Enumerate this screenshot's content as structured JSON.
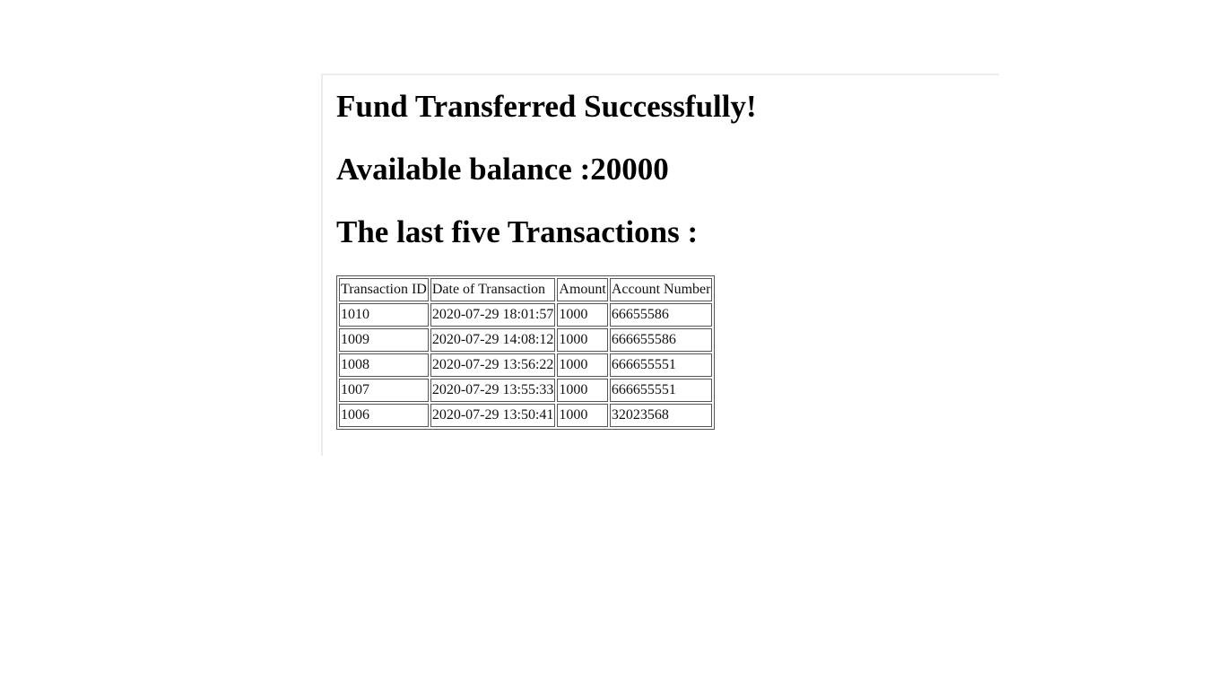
{
  "page": {
    "title": "Fund Transferred Successfully!",
    "balance_label": "Available balance :",
    "balance_value": "20000",
    "transactions_heading": "The last five Transactions :"
  },
  "table": {
    "headers": [
      "Transaction ID",
      "Date of Transaction",
      "Amount",
      "Account Number"
    ],
    "rows": [
      [
        "1010",
        "2020-07-29 18:01:57",
        "1000",
        "66655586"
      ],
      [
        "1009",
        "2020-07-29 14:08:12",
        "1000",
        "666655586"
      ],
      [
        "1008",
        "2020-07-29 13:56:22",
        "1000",
        "666655551"
      ],
      [
        "1007",
        "2020-07-29 13:55:33",
        "1000",
        "666655551"
      ],
      [
        "1006",
        "2020-07-29 13:50:41",
        "1000",
        "32023568"
      ]
    ]
  }
}
